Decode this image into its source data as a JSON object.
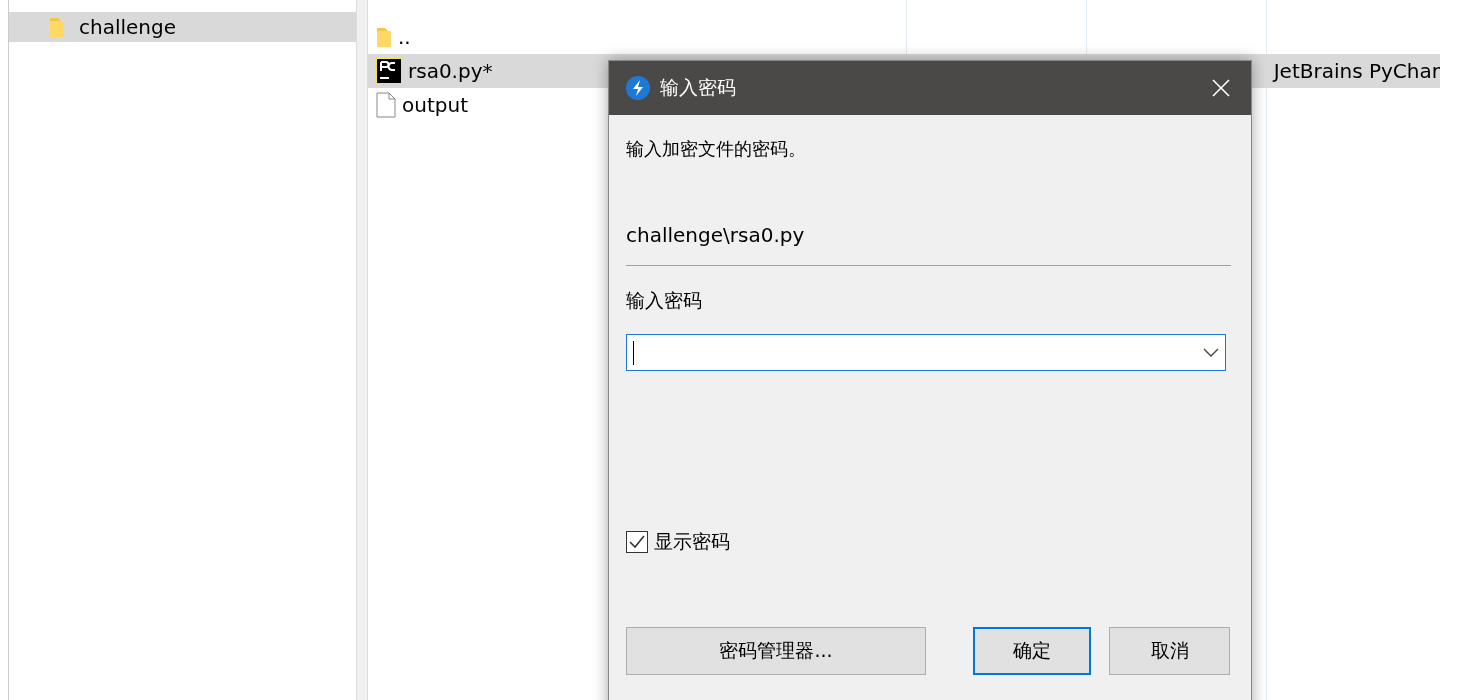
{
  "sidebar": {
    "items": [
      {
        "label": "challenge",
        "selected": true
      }
    ]
  },
  "file_list": {
    "rows": [
      {
        "name": "..",
        "kind": "folder",
        "selected": false
      },
      {
        "name": "rsa0.py*",
        "kind": "pycharm",
        "selected": true,
        "column_4": "JetBrains PyChar"
      },
      {
        "name": "output",
        "kind": "file",
        "selected": false
      }
    ]
  },
  "dialog": {
    "title": "输入密码",
    "message": "输入加密文件的密码。",
    "file_path": "challenge\\rsa0.py",
    "password_label": "输入密码",
    "show_password": {
      "label": "显示密码",
      "checked": true
    },
    "buttons": [
      {
        "label": "密码管理器...",
        "default": false
      },
      {
        "label": "确定",
        "default": true
      },
      {
        "label": "取消",
        "default": false
      }
    ]
  }
}
